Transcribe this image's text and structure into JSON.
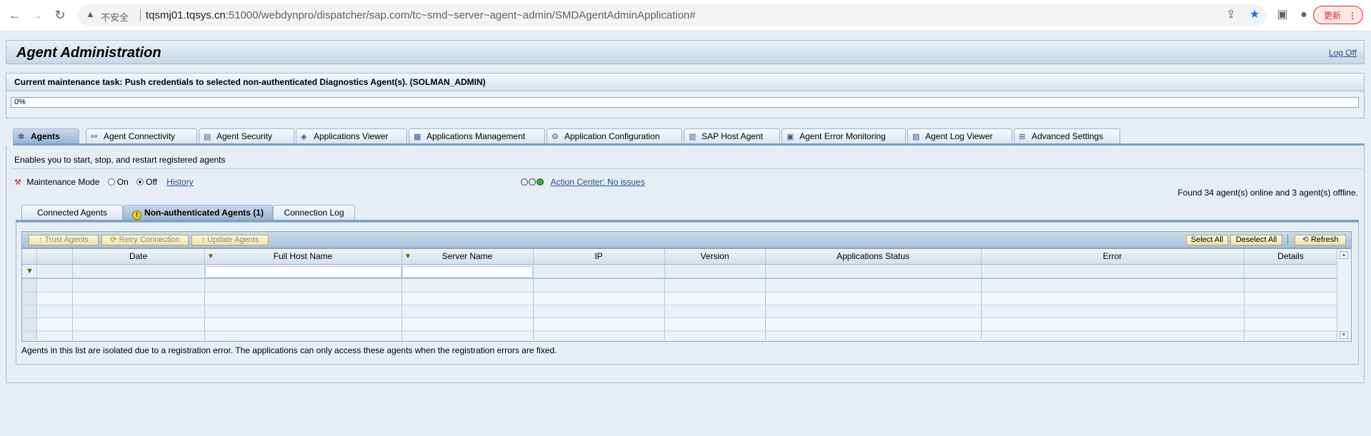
{
  "browser": {
    "insecure_label": "不安全",
    "url_host": "tqsmj01.tqsys.cn",
    "url_rest": ":51000/webdynpro/dispatcher/sap.com/tc~smd~server~agent~admin/SMDAgentAdminApplication#",
    "update_label": "更新"
  },
  "app": {
    "title": "Agent Administration",
    "logoff_label": "Log Off"
  },
  "task": {
    "title": "Current maintenance task: Push credentials to selected non-authenticated Diagnostics Agent(s). (SOLMAN_ADMIN)",
    "progress_label": "0%",
    "progress_value": 0
  },
  "main_tabs": [
    {
      "label": "Agents",
      "icon": "agents-icon",
      "active": true
    },
    {
      "label": "Agent Connectivity",
      "icon": "connectivity-icon"
    },
    {
      "label": "Agent Security",
      "icon": "security-icon"
    },
    {
      "label": "Applications Viewer",
      "icon": "viewer-icon"
    },
    {
      "label": "Applications Management",
      "icon": "management-icon"
    },
    {
      "label": "Application Configuration",
      "icon": "configuration-icon"
    },
    {
      "label": "SAP Host Agent",
      "icon": "host-agent-icon"
    },
    {
      "label": "Agent Error Monitoring",
      "icon": "error-monitoring-icon"
    },
    {
      "label": "Agent Log Viewer",
      "icon": "log-viewer-icon"
    },
    {
      "label": "Advanced Settings",
      "icon": "settings-icon"
    }
  ],
  "panel": {
    "description": "Enables you to start, stop, and restart registered agents",
    "maintenance_mode_label": "Maintenance Mode",
    "on_label": "On",
    "off_label": "Off",
    "history_label": "History",
    "action_center_label": "Action Center: No issues",
    "found_text": "Found 34 agent(s) online and 3 agent(s) offline."
  },
  "sub_tabs": [
    {
      "label": "Connected Agents"
    },
    {
      "label": "Non-authenticated Agents (1)",
      "active": true
    },
    {
      "label": "Connection Log"
    }
  ],
  "toolbar": {
    "trust_label": "Trust Agents",
    "retry_label": "Retry Connection",
    "update_label": "Update Agents",
    "select_all_label": "Select All",
    "deselect_all_label": "Deselect All",
    "refresh_label": "Refresh"
  },
  "table": {
    "columns": [
      "Date",
      "Full Host Name",
      "Server Name",
      "IP",
      "Version",
      "Applications Status",
      "Error",
      "Details"
    ]
  },
  "note": "Agents in this list are isolated due to a registration error. The applications can only access these agents when the registration errors are fixed."
}
